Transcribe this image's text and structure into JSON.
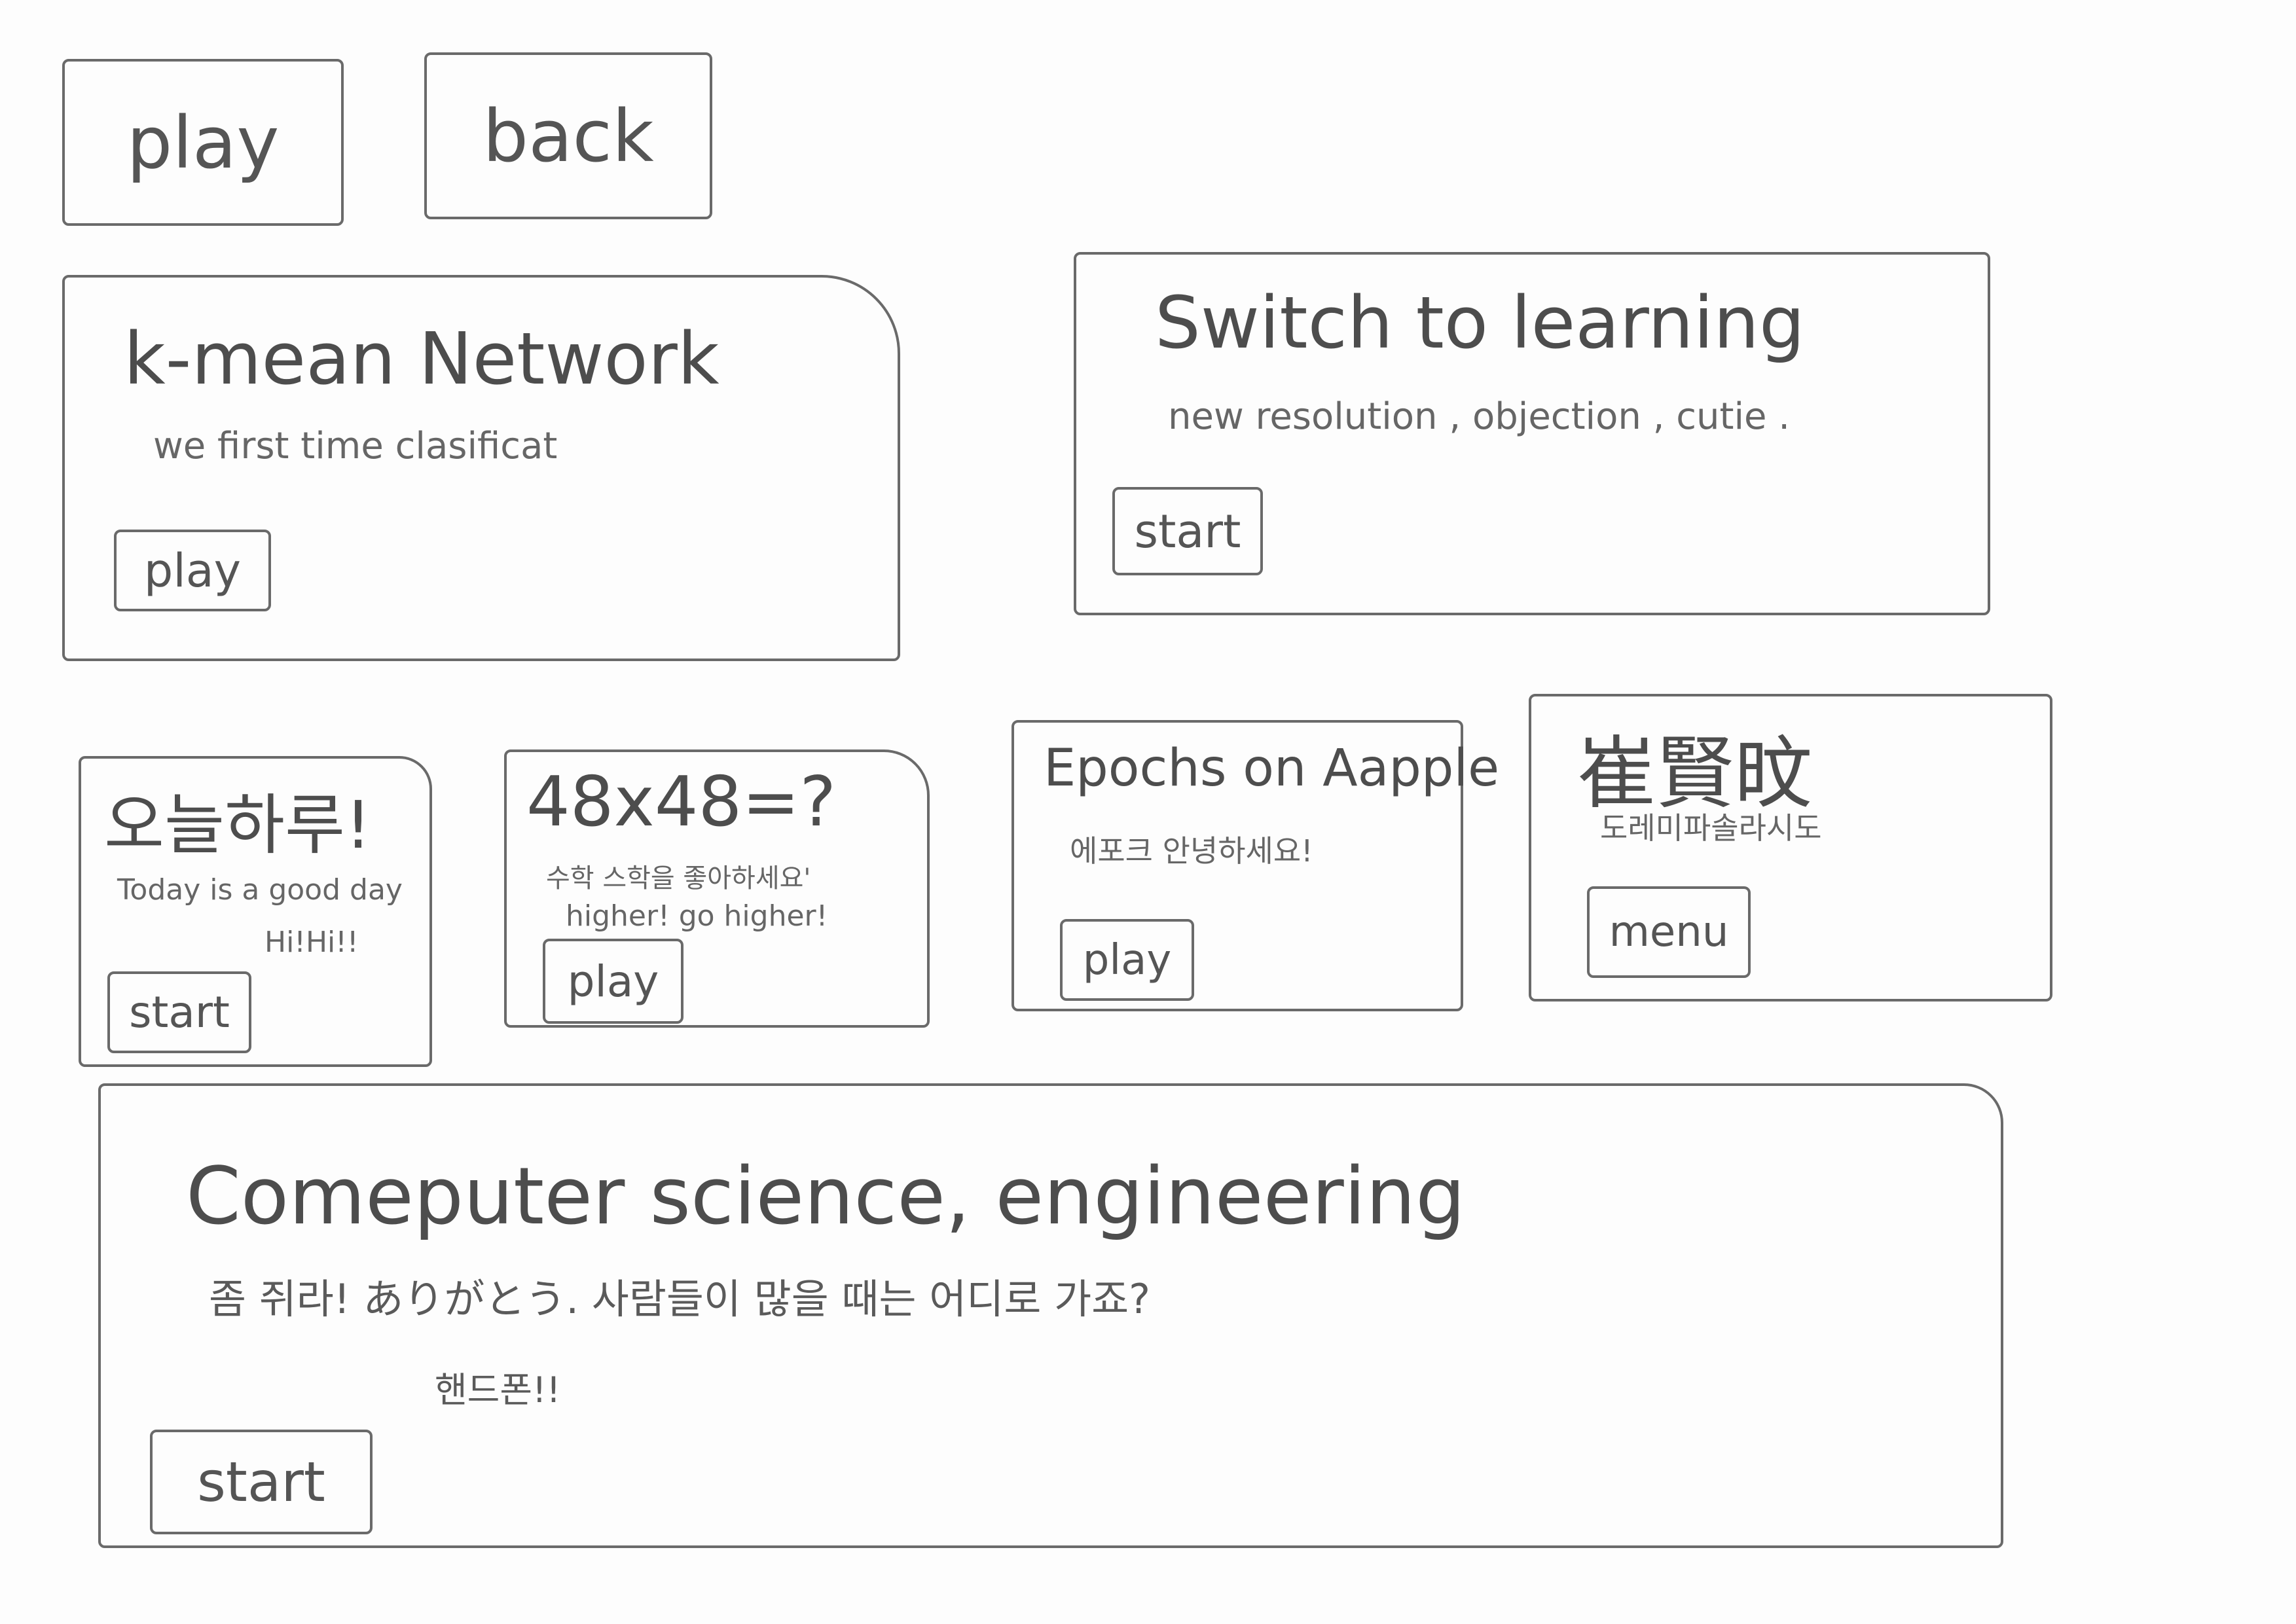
{
  "top_bar": {
    "play_label": "play",
    "back_label": "back"
  },
  "cards": {
    "kmean": {
      "title": "k-mean Network",
      "subtitle": "we first time clasificat",
      "button": "play"
    },
    "switch": {
      "title": "Switch to learning",
      "subtitle": "new resolution , objection , cutie .",
      "button": "start"
    },
    "today": {
      "title": "오늘하루!",
      "line1": "Today is a good day",
      "line2": "Hi!Hi!!",
      "button": "start"
    },
    "math": {
      "title": "48x48=?",
      "line1": "수학 스학을 좋아하세요'",
      "line2": "higher! go higher!",
      "button": "play"
    },
    "epochs": {
      "title": "Epochs on Aapple",
      "subtitle": "에포크 안녕하세요!",
      "button": "play"
    },
    "chinese": {
      "title": "崔賢旼",
      "subtitle": "도레미파솔라시도",
      "button": "menu"
    },
    "cs": {
      "title": "Comeputer science, engineering",
      "line1": "좀 쥐라! ありがとう. 사람들이 많을 때는 어디로 가죠?",
      "line2": "핸드폰!!",
      "button": "start"
    }
  }
}
